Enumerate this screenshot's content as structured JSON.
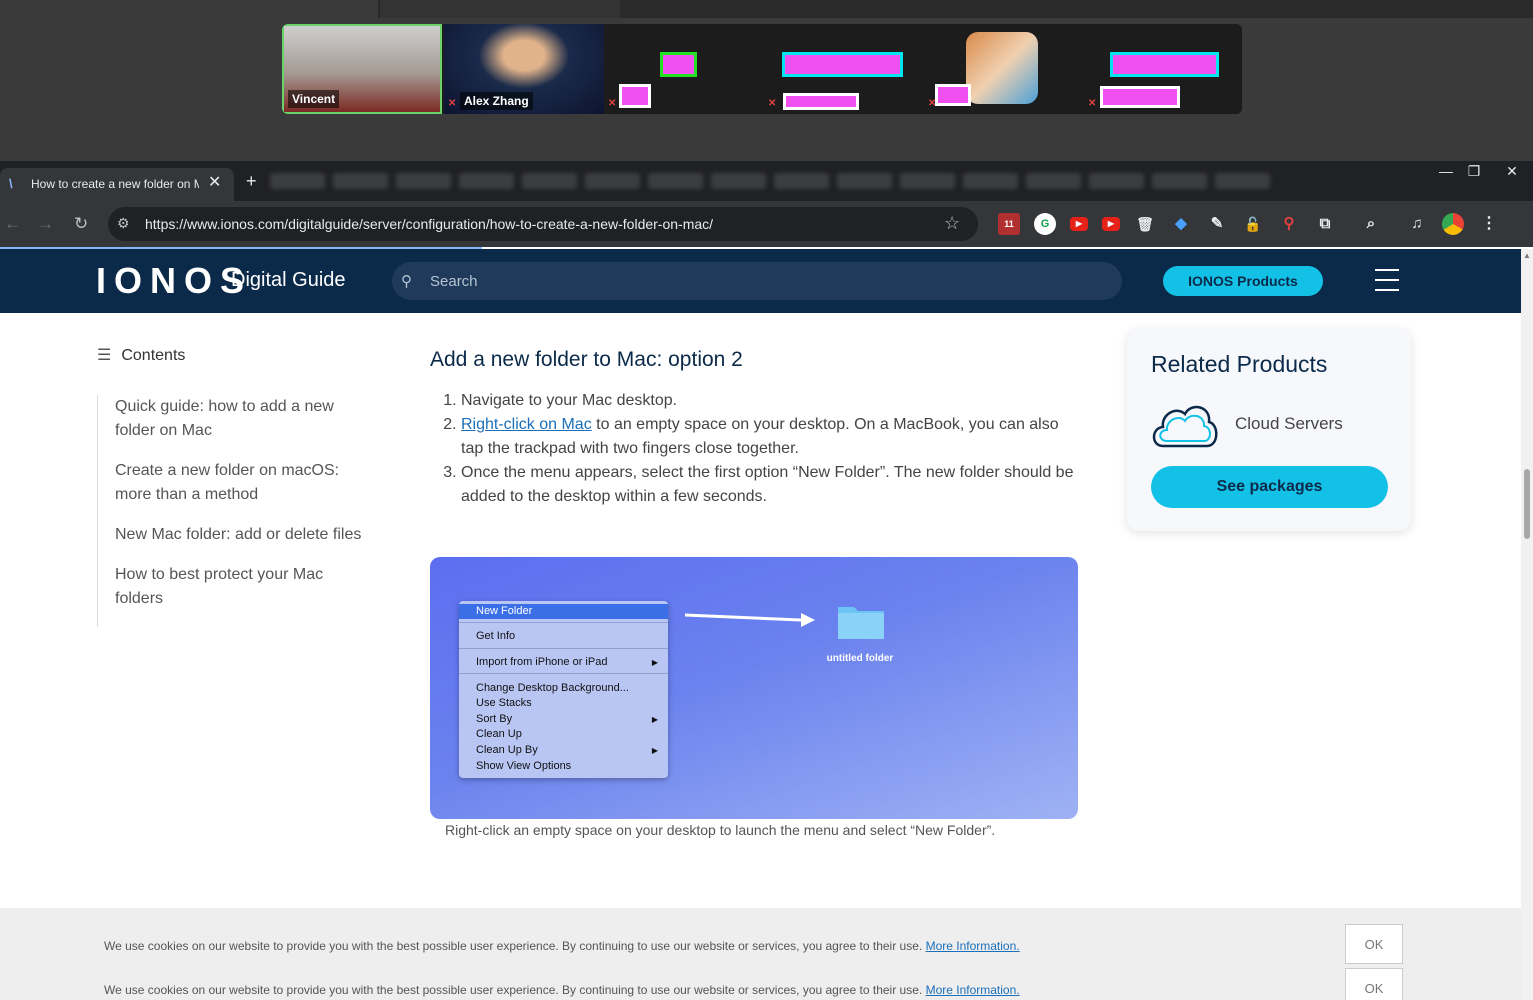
{
  "meeting": {
    "participants": [
      {
        "name": "Vincent"
      },
      {
        "name": "Alex Zhang"
      }
    ]
  },
  "browser": {
    "tab": {
      "title": "How to create a new folder on Mac",
      "favicon": "ionos-favicon"
    },
    "new_tab_label": "+",
    "url": "https://www.ionos.com/digitalguide/server/configuration/how-to-create-a-new-folder-on-mac/",
    "extension_badge": "11"
  },
  "site": {
    "logo": "IONOS",
    "section": "Digital Guide",
    "search_placeholder": "Search",
    "products_button": "IONOS Products"
  },
  "toc": {
    "heading": "Contents",
    "items": [
      {
        "label": "Quick guide: how to add a new folder on Mac"
      },
      {
        "label": "Create a new folder on macOS: more than a method"
      },
      {
        "label": "New Mac folder: add or delete files"
      },
      {
        "label": "How to best protect your Mac folders"
      }
    ]
  },
  "article": {
    "title": "Add a new folder to Mac: option 2",
    "step1": "Navigate to your Mac desktop.",
    "step2_link": "Right-click on Mac",
    "step2_rest": " to an empty space on your desktop. On a MacBook, you can also tap the trackpad with two fingers close together.",
    "step3": "Once the menu appears, select the first option “New Folder”. The new folder should be added to the desktop within a few seconds.",
    "figure": {
      "menu_items": [
        {
          "label": "New Folder"
        },
        {
          "label": "Get Info"
        },
        {
          "label": "Import from iPhone or iPad"
        },
        {
          "label": "Change Desktop Background..."
        },
        {
          "label": "Use Stacks"
        },
        {
          "label": "Sort By"
        },
        {
          "label": "Clean Up"
        },
        {
          "label": "Clean Up By"
        },
        {
          "label": "Show View Options"
        }
      ],
      "folder_label": "untitled folder"
    },
    "caption": "Right-click an empty space on your desktop to launch the menu and select “New Folder”."
  },
  "related": {
    "title": "Related Products",
    "item": "Cloud Servers",
    "button": "See packages"
  },
  "cookie": {
    "text": "We use cookies on our website to provide you with the best possible user experience. By continuing to use our website or services, you agree to their use.",
    "link": "More Information.",
    "ok": "OK"
  },
  "colors": {
    "header_bg": "#0b2a4a",
    "accent": "#14c1e6",
    "link": "#1c6fb8"
  }
}
